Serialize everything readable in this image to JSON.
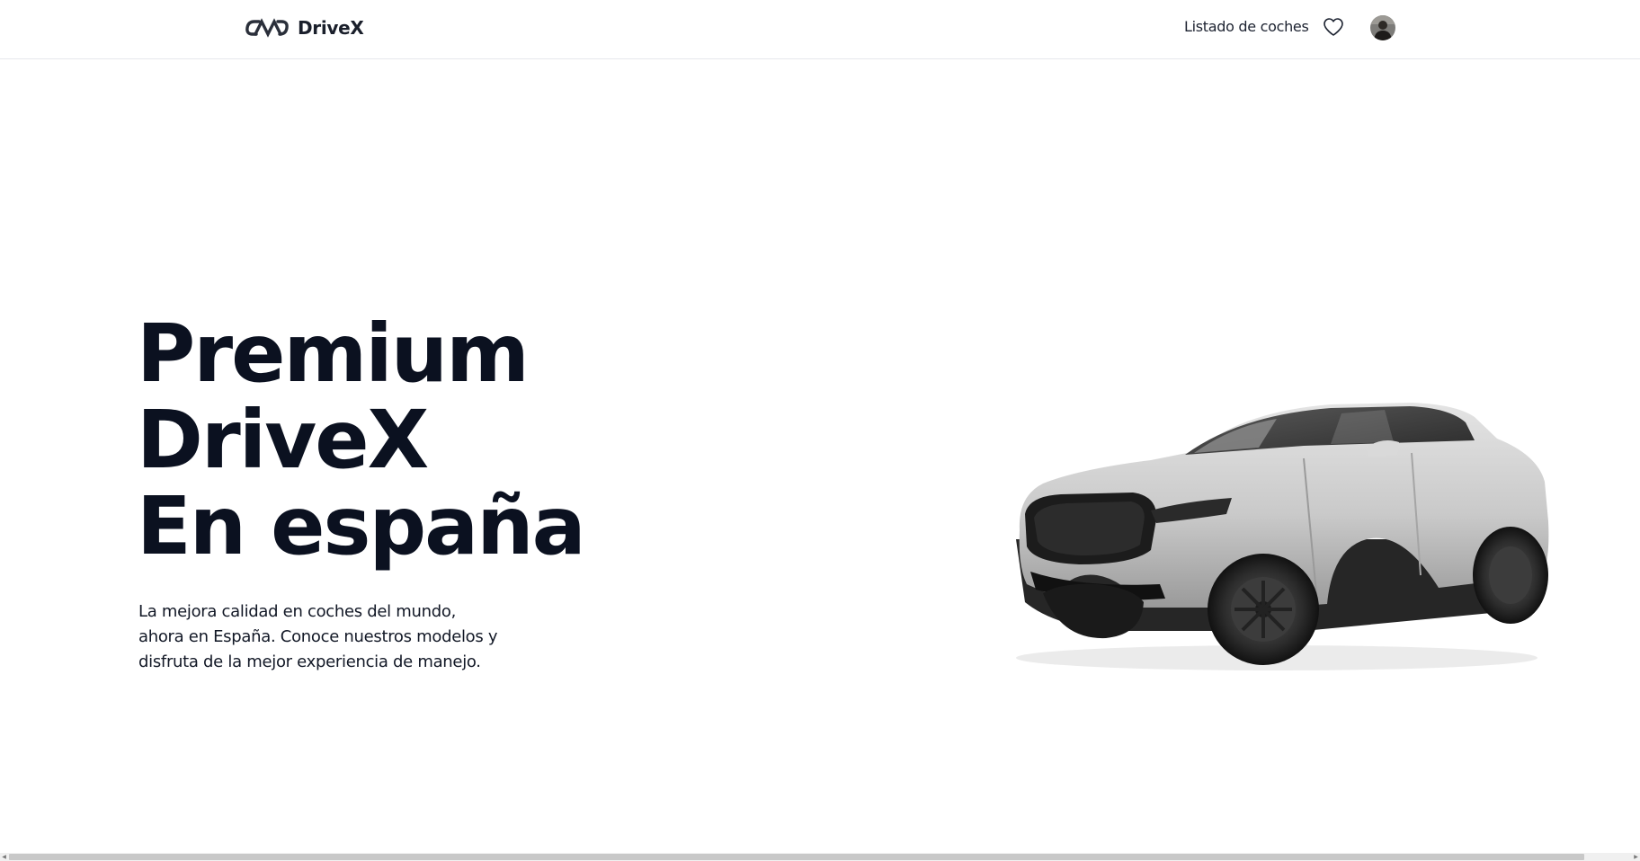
{
  "header": {
    "logo_text": "DriveX",
    "nav_link": "Listado de coches",
    "favorites_icon": "heart-icon",
    "avatar_icon": "user-avatar"
  },
  "hero": {
    "title_lines": [
      "Premium",
      "DriveX",
      "En españa"
    ],
    "description": "La mejora calidad en coches del mundo, ahora en España. Conoce nuestros modelos y disfruta de la mejor experiencia de manejo."
  },
  "colors": {
    "text_dark": "#0b1120",
    "border": "#e6e8ec",
    "background": "#ffffff"
  }
}
